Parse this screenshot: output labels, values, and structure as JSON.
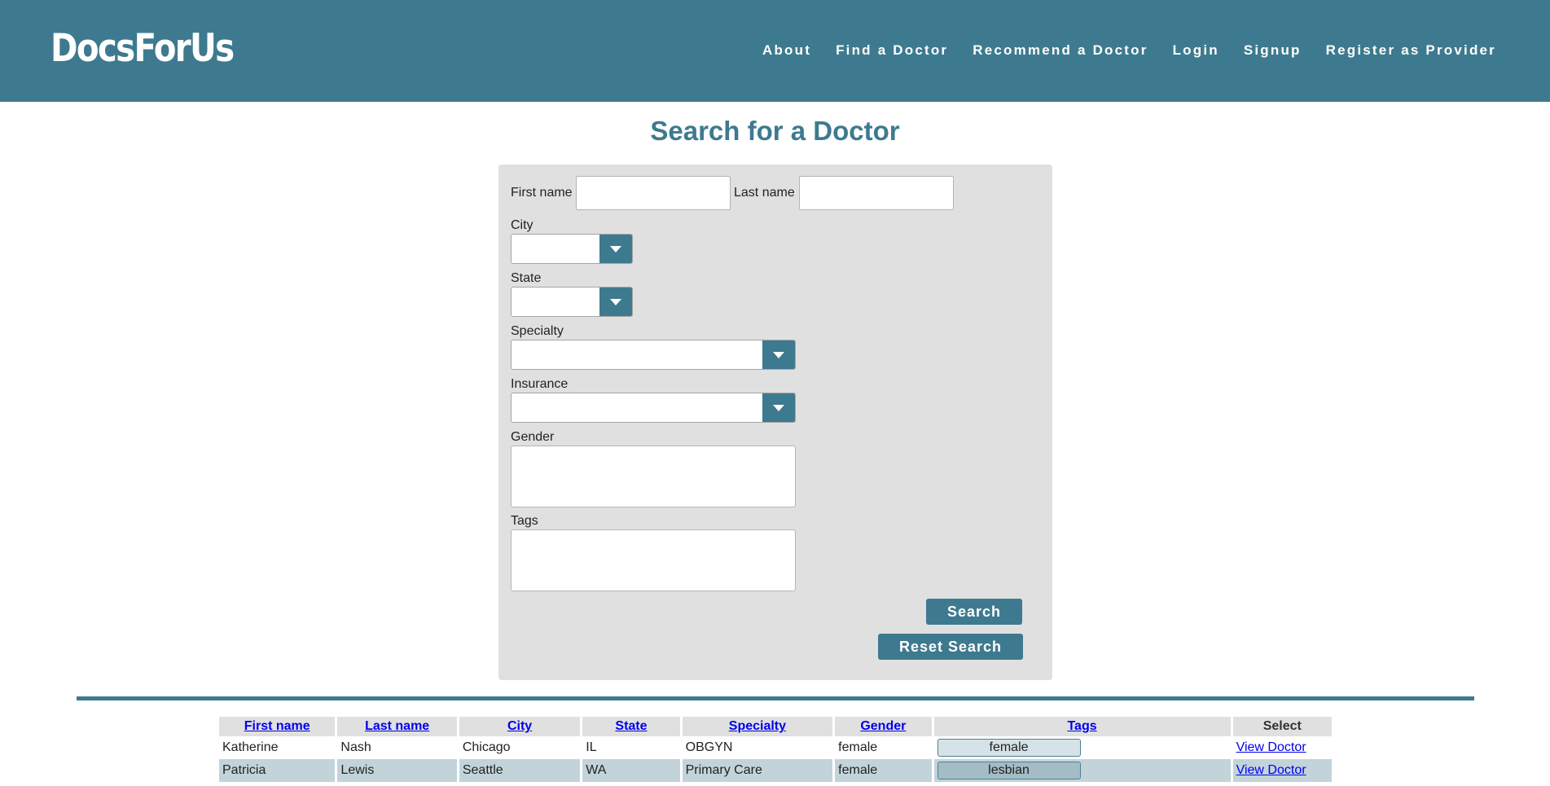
{
  "header": {
    "logo": "DocsForUs",
    "nav": [
      "About",
      "Find a Doctor",
      "Recommend a Doctor",
      "Login",
      "Signup",
      "Register as Provider"
    ]
  },
  "page": {
    "title": "Search for a Doctor"
  },
  "form": {
    "first_name_label": "First name",
    "first_name_value": "",
    "last_name_label": "Last name",
    "last_name_value": "",
    "city_label": "City",
    "city_value": "",
    "state_label": "State",
    "state_value": "",
    "specialty_label": "Specialty",
    "specialty_value": "",
    "insurance_label": "Insurance",
    "insurance_value": "",
    "gender_label": "Gender",
    "tags_label": "Tags",
    "search_label": "Search",
    "reset_label": "Reset Search"
  },
  "table": {
    "headers": [
      "First name",
      "Last name",
      "City",
      "State",
      "Specialty",
      "Gender",
      "Tags",
      "Select"
    ],
    "rows": [
      {
        "first": "Katherine",
        "last": "Nash",
        "city": "Chicago",
        "state": "IL",
        "specialty": "OBGYN",
        "gender": "female",
        "tag": "female",
        "action": "View Doctor"
      },
      {
        "first": "Patricia",
        "last": "Lewis",
        "city": "Seattle",
        "state": "WA",
        "specialty": "Primary Care",
        "gender": "female",
        "tag": "lesbian",
        "action": "View Doctor"
      }
    ]
  },
  "colors": {
    "brand": "#3e7a8f",
    "panel": "#e0e0e0",
    "row_alt": "#c2d4da"
  },
  "icons": [
    "chevron-down-icon"
  ]
}
